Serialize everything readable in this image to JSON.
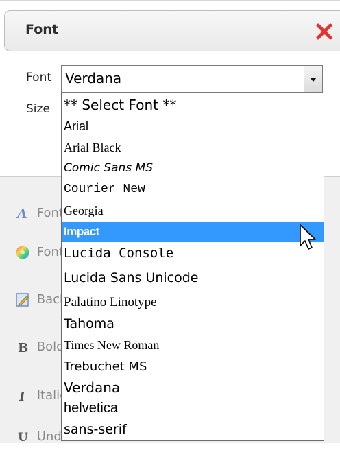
{
  "dialog": {
    "title": "Font"
  },
  "form": {
    "font_label": "Font",
    "size_label": "Size",
    "font_select_value": "Verdana"
  },
  "side_items": [
    {
      "label": "Font",
      "icon": "font-color-icon"
    },
    {
      "label": "Font",
      "icon": "color-wheel-icon"
    },
    {
      "label": "Background",
      "icon": "edit-icon"
    },
    {
      "label": "Bold",
      "icon": "bold-icon"
    },
    {
      "label": "Italic",
      "icon": "italic-icon"
    },
    {
      "label": "Underline",
      "icon": "underline-icon"
    }
  ],
  "font_options": [
    "** Select Font **",
    "Arial",
    "Arial Black",
    "Comic Sans MS",
    "Courier New",
    "Georgia",
    "Impact",
    "Lucida Console",
    "Lucida Sans Unicode",
    "Palatino Linotype",
    "Tahoma",
    "Times New Roman",
    "Trebuchet MS",
    "Verdana",
    "helvetica",
    "sans-serif"
  ],
  "highlighted_option": "Impact",
  "colors": {
    "highlight": "#3399ff",
    "close_icon": "#e8312f"
  }
}
